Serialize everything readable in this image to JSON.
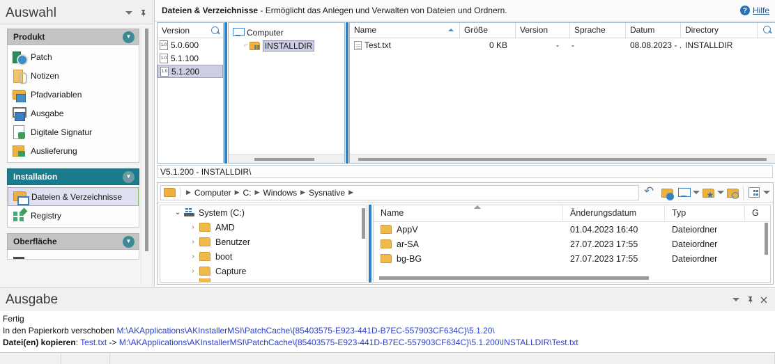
{
  "sidebar": {
    "title": "Auswahl",
    "controls": [
      {
        "name": "dropdown-icon",
        "glyph": ""
      },
      {
        "name": "pin-icon",
        "glyph": "⊥"
      }
    ],
    "groups": [
      {
        "title": "Produkt",
        "active": false,
        "items": [
          {
            "label": "Patch",
            "icon": "patch-icon",
            "selected": false
          },
          {
            "label": "Notizen",
            "icon": "notes-icon",
            "selected": false
          },
          {
            "label": "Pfadvariablen",
            "icon": "path-variables-icon",
            "selected": false
          },
          {
            "label": "Ausgabe",
            "icon": "output-icon",
            "selected": false
          },
          {
            "label": "Digitale Signatur",
            "icon": "digital-signature-icon",
            "selected": false
          },
          {
            "label": "Auslieferung",
            "icon": "delivery-icon",
            "selected": false
          }
        ]
      },
      {
        "title": "Installation",
        "active": true,
        "items": [
          {
            "label": "Dateien & Verzeichnisse",
            "icon": "files-directories-icon",
            "selected": true
          },
          {
            "label": "Registry",
            "icon": "registry-icon",
            "selected": false
          }
        ]
      },
      {
        "title": "Oberfläche",
        "active": false,
        "items": [
          {
            "label": "",
            "icon": "ui-icon",
            "selected": false
          }
        ]
      }
    ]
  },
  "main": {
    "title_bold": "Dateien & Verzeichnisse",
    "title_rest": " - Ermöglicht das Anlegen und Verwalten von Dateien und Ordnern.",
    "help": {
      "label": "Hilfe",
      "icon_glyph": "?"
    },
    "version_pane": {
      "header": "Version",
      "search_icon": "search-icon",
      "rows": [
        {
          "label": "5.0.600",
          "icon_text": "1.0",
          "selected": false
        },
        {
          "label": "5.1.100",
          "icon_text": "1.0",
          "selected": false
        },
        {
          "label": "5.1.200",
          "icon_text": "1.0",
          "selected": true
        }
      ]
    },
    "tree_pane": {
      "root": {
        "label": "Computer",
        "icon": "computer-icon"
      },
      "child": {
        "label": "INSTALLDIR",
        "icon": "install-folder-icon",
        "selected": true
      }
    },
    "files_pane": {
      "columns": [
        "Name",
        "Größe",
        "Version",
        "Sprache",
        "Datum",
        "Directory"
      ],
      "sort_column": "Name",
      "search_icon": "search-icon",
      "rows": [
        {
          "name": "Test.txt",
          "size": "0 KB",
          "version": "-",
          "language": "-",
          "date": "08.08.2023 - ...",
          "directory": "INSTALLDIR"
        }
      ]
    },
    "path_status": "V5.1.200 - INSTALLDIR\\"
  },
  "explorer": {
    "breadcrumb": {
      "folder_icon": "folder-icon",
      "parts": [
        "Computer",
        "C:",
        "Windows",
        "Sysnative"
      ],
      "separator": "▶"
    },
    "toolbar": [
      {
        "name": "undo-button",
        "icon": "undo-icon",
        "has_dropdown": false
      },
      {
        "name": "folder-up-button",
        "icon": "folder-up-icon",
        "has_dropdown": false
      },
      {
        "name": "computer-button",
        "icon": "computer-icon",
        "has_dropdown": true
      },
      {
        "name": "favorites-button",
        "icon": "folder-favorite-icon",
        "has_dropdown": true
      },
      {
        "name": "search-folder-button",
        "icon": "folder-search-icon",
        "has_dropdown": false
      },
      {
        "name": "view-layout-button",
        "icon": "view-layout-icon",
        "has_dropdown": true
      }
    ],
    "tree": {
      "root": {
        "label": "System (C:)",
        "icon": "drive-icon",
        "expanded": true
      },
      "children": [
        {
          "label": "AMD",
          "icon": "folder-icon",
          "expanded": false
        },
        {
          "label": "Benutzer",
          "icon": "folder-icon",
          "expanded": false
        },
        {
          "label": "boot",
          "icon": "folder-icon",
          "expanded": false
        },
        {
          "label": "Capture",
          "icon": "folder-icon",
          "expanded": false
        }
      ]
    },
    "list": {
      "columns": [
        "Name",
        "Änderungsdatum",
        "Typ",
        "G"
      ],
      "rows": [
        {
          "name": "AppV",
          "modified": "01.04.2023 16:40",
          "type": "Dateiordner",
          "size": ""
        },
        {
          "name": "ar-SA",
          "modified": "27.07.2023 17:55",
          "type": "Dateiordner",
          "size": ""
        },
        {
          "name": "bg-BG",
          "modified": "27.07.2023 17:55",
          "type": "Dateiordner",
          "size": ""
        }
      ]
    }
  },
  "output": {
    "title": "Ausgabe",
    "controls": [
      {
        "name": "dropdown-icon"
      },
      {
        "name": "pin-icon"
      },
      {
        "name": "close-icon"
      }
    ],
    "lines": [
      {
        "prefix": "Fertig",
        "bold_prefix": "",
        "link": "",
        "mid": "",
        "link2": ""
      },
      {
        "bold_prefix": "",
        "prefix": "In den Papierkorb verschoben ",
        "link": "M:\\AKApplications\\AKInstallerMSI\\PatchCache\\{85403575-E923-441D-B7EC-557903CF634C}\\5.1.20\\",
        "mid": "",
        "link2": ""
      },
      {
        "bold_prefix": "Datei(en) kopieren",
        "prefix": ": ",
        "link": "Test.txt",
        "mid": " -> ",
        "link2": "M:\\AKApplications\\AKInstallerMSI\\PatchCache\\{85403575-E923-441D-B7EC-557903CF634C}\\5.1.200\\INSTALLDIR\\Test.txt"
      }
    ]
  },
  "colors": {
    "accent_teal": "#1a7b8c",
    "splitter_blue": "#2f7fc1",
    "link_blue": "#2a3fd0",
    "selection": "#cdd0e4",
    "folder_yellow": "#eeb13f"
  }
}
